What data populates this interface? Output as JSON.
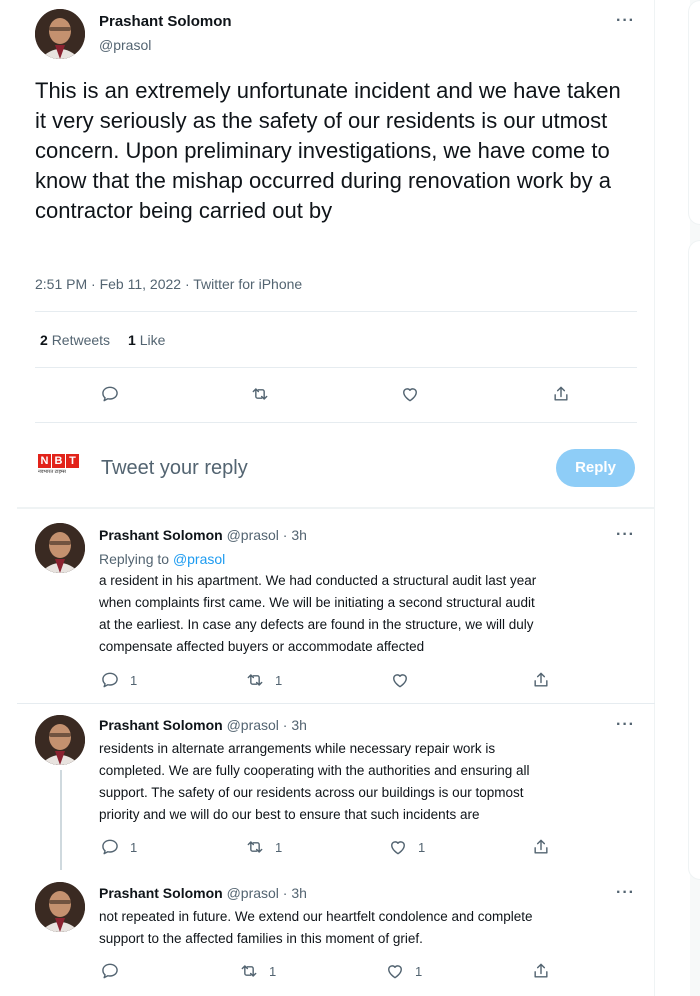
{
  "main_tweet": {
    "author_name": "Prashant Solomon",
    "author_handle": "@prasol",
    "text": "This is an extremely unfortunate incident and we have taken it very seriously as the safety of our residents is our utmost concern. Upon preliminary investigations, we have come to know that the mishap occurred during renovation work by a contractor being carried out by",
    "timestamp": "2:51 PM · Feb 11, 2022 · Twitter for iPhone",
    "retweets_count": "2",
    "retweets_label": "Retweets",
    "likes_count": "1",
    "likes_label": "Like",
    "more_label": "···"
  },
  "reply_box": {
    "logo_letters": [
      "N",
      "B",
      "T"
    ],
    "logo_subtext": "नवभारत टाइम्स",
    "placeholder": "Tweet your reply",
    "button_label": "Reply"
  },
  "replies": [
    {
      "author_name": "Prashant Solomon",
      "meta": "@prasol · 3h",
      "replying_prefix": "Replying to",
      "replying_to": "@prasol",
      "lines": [
        "a resident in his apartment. We had conducted a structural audit last year",
        "when complaints first came. We will be initiating a second structural audit",
        "at the earliest. In case any defects are found in the structure, we will duly",
        "compensate affected buyers or accommodate affected"
      ],
      "reply_count": "1",
      "retweet_count": "1",
      "like_count": ""
    },
    {
      "author_name": "Prashant Solomon",
      "meta": "@prasol · 3h",
      "lines": [
        "residents in alternate arrangements while necessary repair work is",
        "completed. We are fully cooperating with the authorities and ensuring all",
        "support. The safety of our residents across our buildings is our topmost",
        "priority and we will do our best to ensure that such incidents are"
      ],
      "reply_count": "1",
      "retweet_count": "1",
      "like_count": "1"
    },
    {
      "author_name": "Prashant Solomon",
      "meta": "@prasol · 3h",
      "lines": [
        "not repeated in future. We extend our heartfelt condolence and complete",
        "support to the affected families in this moment of grief."
      ],
      "reply_count": "",
      "retweet_count": "1",
      "like_count": "1"
    }
  ],
  "colors": {
    "accent": "#1d9bf0",
    "reply_button": "#8ecdf7",
    "secondary_text": "#536471",
    "nbt_red": "#e2231a"
  },
  "icons": [
    "reply-icon",
    "retweet-icon",
    "like-icon",
    "share-icon",
    "more-icon"
  ]
}
